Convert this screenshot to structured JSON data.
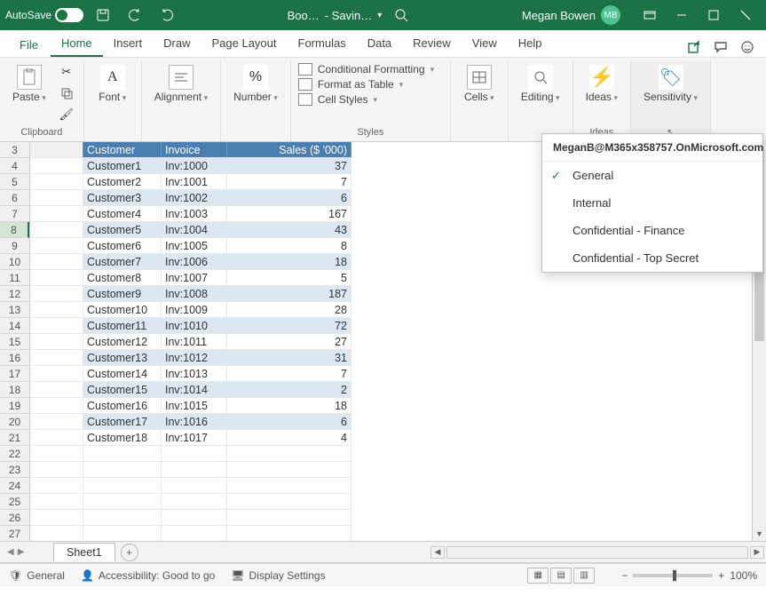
{
  "titlebar": {
    "autosave_label": "AutoSave",
    "autosave_state": "On",
    "doc_name": "Boo…",
    "saving": "- Savin…",
    "user_name": "Megan Bowen",
    "user_initials": "MB"
  },
  "tabs": {
    "file": "File",
    "items": [
      "Home",
      "Insert",
      "Draw",
      "Page Layout",
      "Formulas",
      "Data",
      "Review",
      "View",
      "Help"
    ],
    "active": "Home"
  },
  "ribbon": {
    "clipboard": {
      "paste": "Paste",
      "label": "Clipboard"
    },
    "font": {
      "btn": "Font",
      "label": ""
    },
    "alignment": {
      "btn": "Alignment"
    },
    "number": {
      "btn": "Number"
    },
    "styles": {
      "cf": "Conditional Formatting",
      "fat": "Format as Table",
      "cs": "Cell Styles",
      "label": "Styles"
    },
    "cells": {
      "btn": "Cells"
    },
    "editing": {
      "btn": "Editing"
    },
    "ideas": {
      "btn": "Ideas",
      "label": "Ideas"
    },
    "sensitivity": {
      "btn": "Sensitivity"
    }
  },
  "sheet": {
    "headers": {
      "b": "Customer",
      "c": "Invoice",
      "d": "Sales ($ '000)"
    },
    "rows": [
      {
        "n": 4,
        "b": "Customer1",
        "c": "Inv:1000",
        "d": "37"
      },
      {
        "n": 5,
        "b": "Customer2",
        "c": "Inv:1001",
        "d": "7"
      },
      {
        "n": 6,
        "b": "Customer3",
        "c": "Inv:1002",
        "d": "6"
      },
      {
        "n": 7,
        "b": "Customer4",
        "c": "Inv:1003",
        "d": "167"
      },
      {
        "n": 8,
        "b": "Customer5",
        "c": "Inv:1004",
        "d": "43"
      },
      {
        "n": 9,
        "b": "Customer6",
        "c": "Inv:1005",
        "d": "8"
      },
      {
        "n": 10,
        "b": "Customer7",
        "c": "Inv:1006",
        "d": "18"
      },
      {
        "n": 11,
        "b": "Customer8",
        "c": "Inv:1007",
        "d": "5"
      },
      {
        "n": 12,
        "b": "Customer9",
        "c": "Inv:1008",
        "d": "187"
      },
      {
        "n": 13,
        "b": "Customer10",
        "c": "Inv:1009",
        "d": "28"
      },
      {
        "n": 14,
        "b": "Customer11",
        "c": "Inv:1010",
        "d": "72"
      },
      {
        "n": 15,
        "b": "Customer12",
        "c": "Inv:1011",
        "d": "27"
      },
      {
        "n": 16,
        "b": "Customer13",
        "c": "Inv:1012",
        "d": "31"
      },
      {
        "n": 17,
        "b": "Customer14",
        "c": "Inv:1013",
        "d": "7"
      },
      {
        "n": 18,
        "b": "Customer15",
        "c": "Inv:1014",
        "d": "2"
      },
      {
        "n": 19,
        "b": "Customer16",
        "c": "Inv:1015",
        "d": "18"
      },
      {
        "n": 20,
        "b": "Customer17",
        "c": "Inv:1016",
        "d": "6"
      },
      {
        "n": 21,
        "b": "Customer18",
        "c": "Inv:1017",
        "d": "4"
      }
    ],
    "empty_rows": [
      22,
      23,
      24,
      25,
      26,
      27
    ],
    "first_row": 3,
    "selected_row": 8,
    "tab_name": "Sheet1"
  },
  "status": {
    "sens": "General",
    "acc": "Accessibility: Good to go",
    "disp": "Display Settings",
    "zoom": "100%"
  },
  "dropdown": {
    "header": "MeganB@M365x358757.OnMicrosoft.com",
    "items": [
      "General",
      "Internal",
      "Confidential - Finance",
      "Confidential - Top Secret"
    ],
    "selected": "General"
  }
}
